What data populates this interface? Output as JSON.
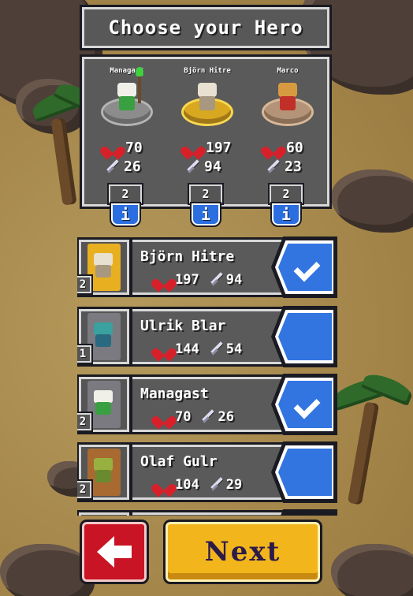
{
  "title": "Choose your Hero",
  "team": [
    {
      "name": "Managast",
      "hp": "70",
      "atk": "26",
      "level": "2",
      "info": "i"
    },
    {
      "name": "Björn Hitre",
      "hp": "197",
      "atk": "94",
      "level": "2",
      "info": "i"
    },
    {
      "name": "Marco",
      "hp": "60",
      "atk": "23",
      "level": "2",
      "info": "i"
    }
  ],
  "heroes": [
    {
      "name": "Björn Hitre",
      "hp": "197",
      "atk": "94",
      "level": "2",
      "selected": true
    },
    {
      "name": "Ulrik Blar",
      "hp": "144",
      "atk": "54",
      "level": "1",
      "selected": false
    },
    {
      "name": "Managast",
      "hp": "70",
      "atk": "26",
      "level": "2",
      "selected": true
    },
    {
      "name": "Olaf Gulr",
      "hp": "104",
      "atk": "29",
      "level": "2",
      "selected": false
    }
  ],
  "buttons": {
    "next": "Next"
  },
  "icons": {
    "health": "heart-icon",
    "attack": "sword-icon",
    "info": "info-icon",
    "back": "back-arrow-icon",
    "selected": "checkmark-icon"
  },
  "colors": {
    "accent_blue": "#3275e0",
    "next_yellow": "#f2b61c",
    "back_red": "#c81424",
    "panel_gray": "#5a5a5a"
  }
}
